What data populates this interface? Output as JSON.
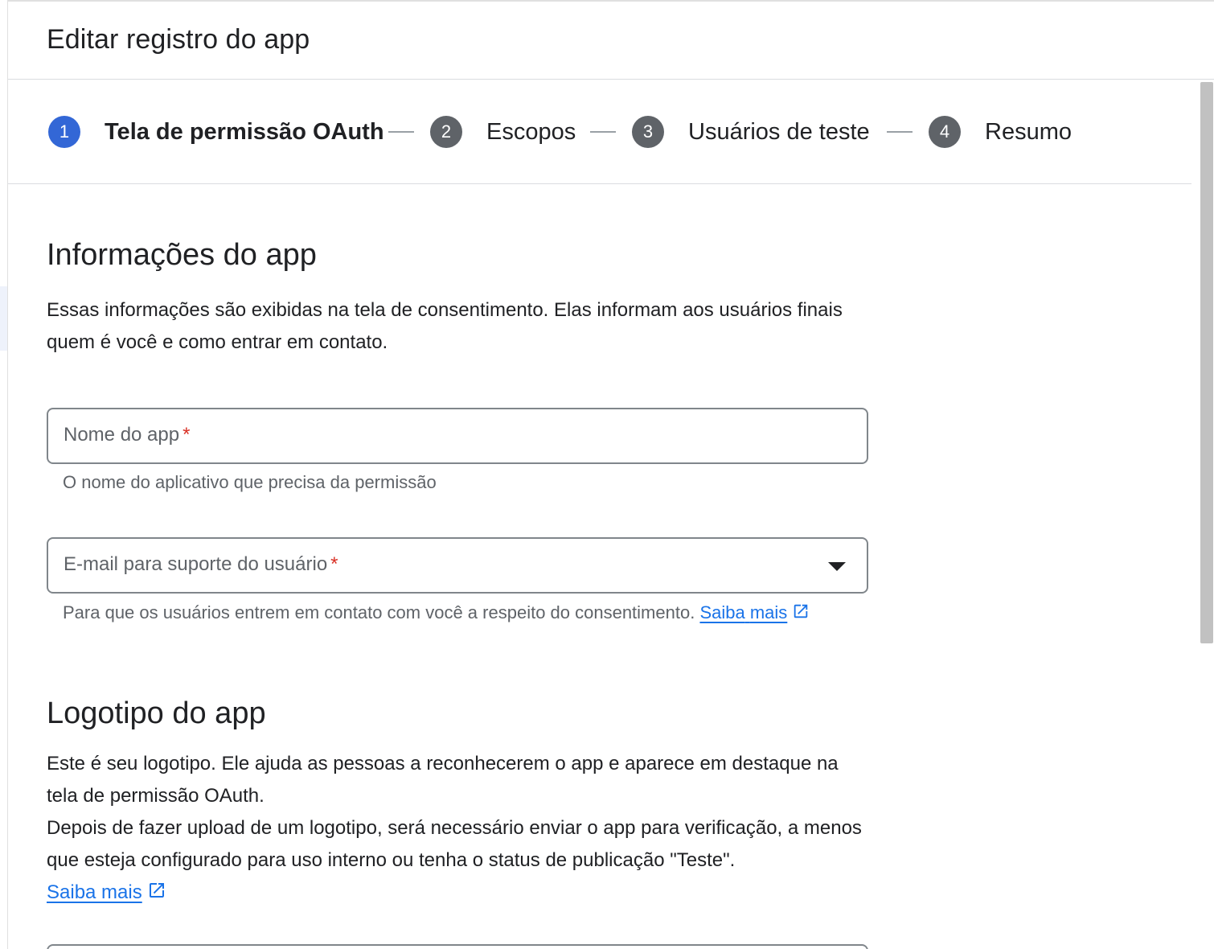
{
  "header": {
    "title": "Editar registro do app"
  },
  "stepper": {
    "steps": [
      {
        "num": "1",
        "label": "Tela de permissão OAuth"
      },
      {
        "num": "2",
        "label": "Escopos"
      },
      {
        "num": "3",
        "label": "Usuários de teste"
      },
      {
        "num": "4",
        "label": "Resumo"
      }
    ],
    "active_color": "#3367d6",
    "inactive_color": "#5f6368"
  },
  "app_info": {
    "heading": "Informações do app",
    "description": "Essas informações são exibidas na tela de consentimento. Elas informam aos usuários finais quem é você e como entrar em contato.",
    "app_name": {
      "placeholder": "Nome do app",
      "required": "*",
      "hint": "O nome do aplicativo que precisa da permissão",
      "value": ""
    },
    "support_email": {
      "placeholder": "E-mail para suporte do usuário",
      "required": "*",
      "hint": "Para que os usuários entrem em contato com você a respeito do consentimento.",
      "link_part1": "Saiba",
      "link_part2": "mais"
    }
  },
  "logo": {
    "heading": "Logotipo do app",
    "description_line1": "Este é seu logotipo. Ele ajuda as pessoas a reconhecerem o app e aparece em destaque na tela de permissão OAuth.",
    "description_line2": "Depois de fazer upload de um logotipo, será necessário enviar o app para verificação, a menos que esteja configurado para uso interno ou tenha o status de publicação \"Teste\".",
    "learn_more": "Saiba mais"
  },
  "colors": {
    "link": "#1a73e8",
    "required": "#d93025"
  }
}
